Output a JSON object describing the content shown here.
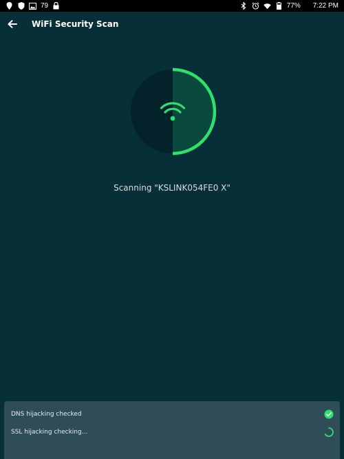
{
  "status_bar": {
    "temperature": "79",
    "battery": "77%",
    "time": "7:22 PM",
    "left_icons": [
      "pin-icon",
      "shield-icon",
      "gallery-icon",
      "lock-icon"
    ],
    "right_icons": [
      "bluetooth-icon",
      "alarm-icon",
      "wifi-icon",
      "battery-icon"
    ]
  },
  "header": {
    "title": "WiFi Security Scan",
    "back_icon": "arrow-left-icon"
  },
  "scanner": {
    "icon": "wifi-icon",
    "progress_fraction": 0.5,
    "accent": "#2ee16d",
    "fill": "#0a4a3e",
    "disc": "#042229"
  },
  "scan": {
    "text": "Scanning \"KSLINK054FE0 X\""
  },
  "checks": [
    {
      "label": "DNS hijacking checked",
      "state": "done"
    },
    {
      "label": "SSL hijacking checking...",
      "state": "in-progress"
    }
  ],
  "colors": {
    "background": "#062f37",
    "panel": "#2e4d57",
    "accent": "#2ee16d"
  }
}
